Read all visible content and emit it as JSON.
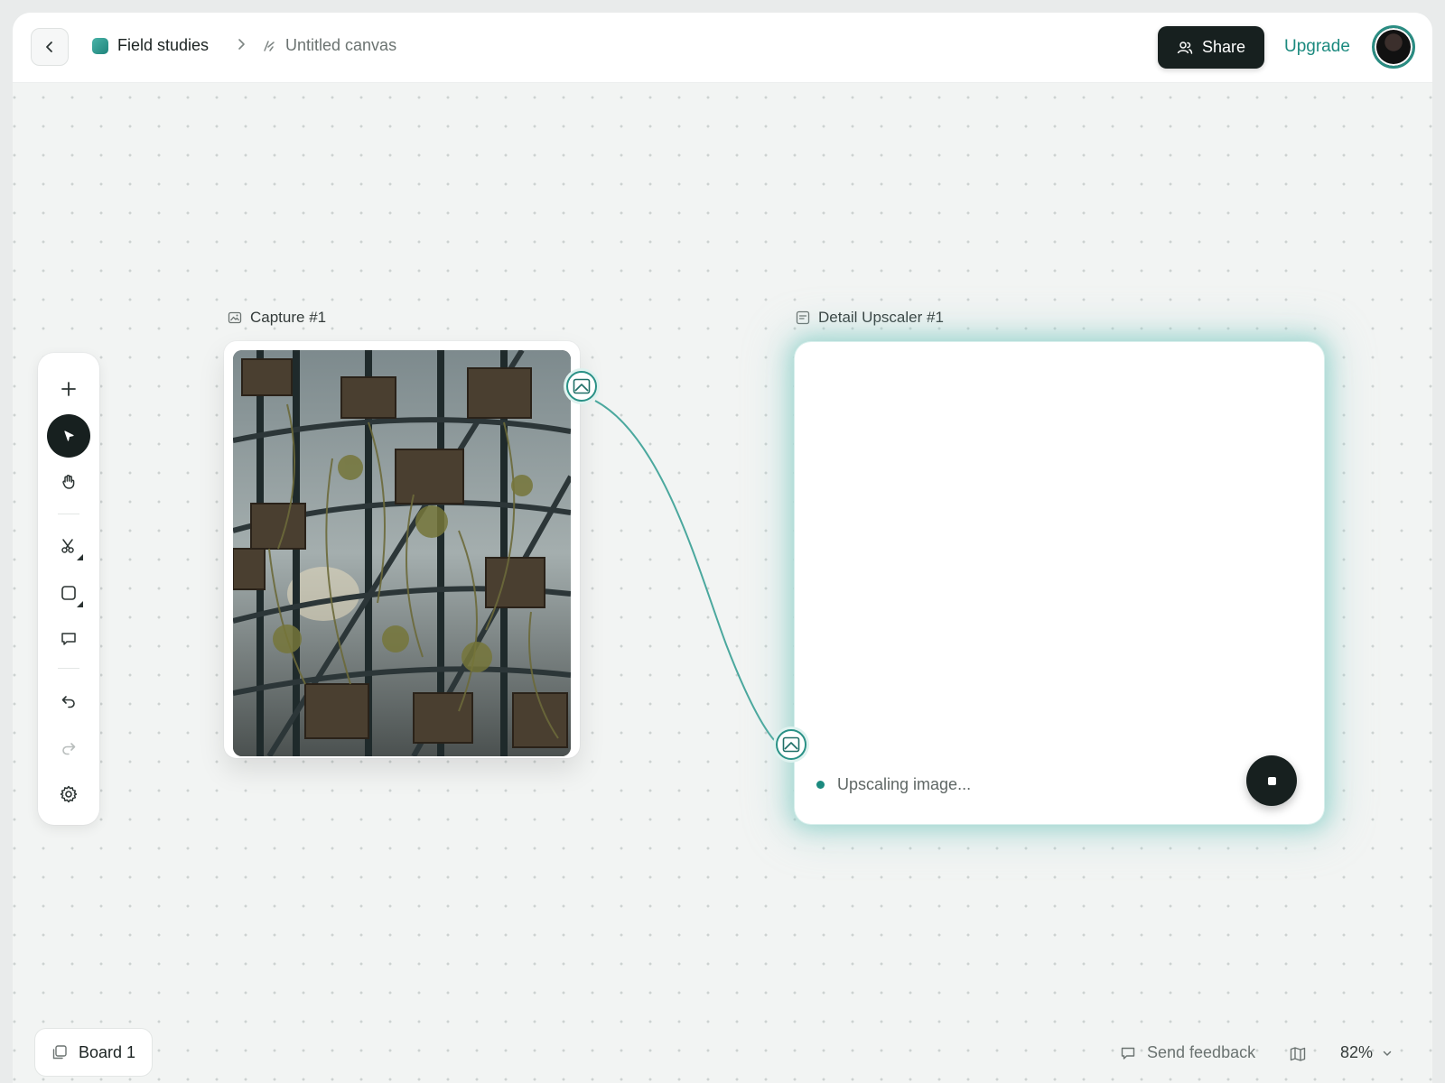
{
  "header": {
    "project_name": "Field studies",
    "canvas_name": "Untitled canvas",
    "share_label": "Share",
    "upgrade_label": "Upgrade"
  },
  "toolbar": {
    "tools": [
      "add",
      "select",
      "pan",
      "cut",
      "shape",
      "comment",
      "undo",
      "redo",
      "settings"
    ],
    "active_tool": "select"
  },
  "nodes": {
    "capture": {
      "title": "Capture #1"
    },
    "upscaler": {
      "title": "Detail Upscaler #1",
      "status": "Upscaling image..."
    }
  },
  "footer": {
    "board_label": "Board 1",
    "feedback_label": "Send feedback",
    "zoom_level": "82%"
  },
  "colors": {
    "accent": "#1c8a7f",
    "dark": "#17201f",
    "glow": "#78c8c0"
  },
  "icons": [
    "chevron-left-icon",
    "chevron-right-icon",
    "canvas-icon",
    "users-icon",
    "plus-icon",
    "cursor-icon",
    "hand-icon",
    "scissors-icon",
    "square-icon",
    "comment-icon",
    "undo-icon",
    "redo-icon",
    "gear-icon",
    "image-icon",
    "board-icon",
    "map-icon",
    "chevron-down-icon",
    "stop-icon"
  ]
}
